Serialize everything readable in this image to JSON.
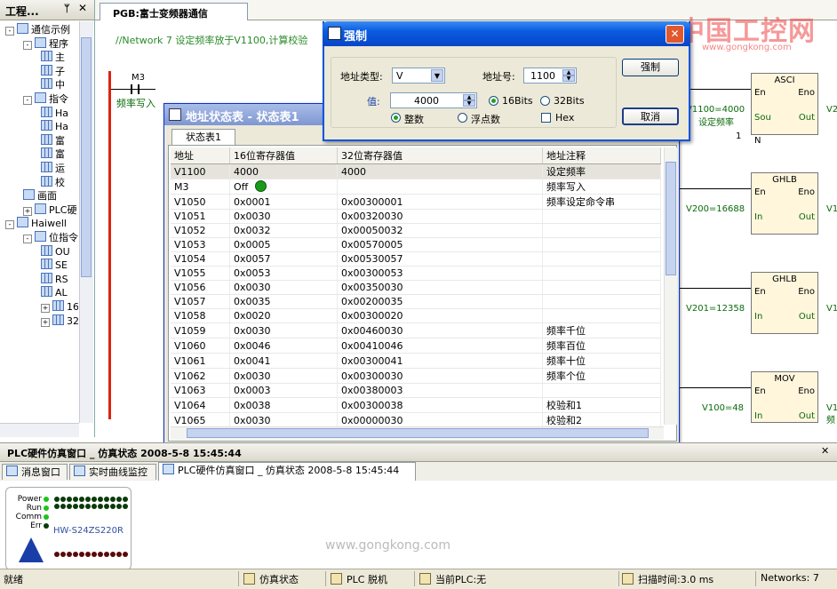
{
  "left_pane": {
    "title": "工程...",
    "pin_icon": "pin-icon",
    "tree": [
      {
        "label": "通信示例",
        "level": 1,
        "exp": "-"
      },
      {
        "label": "程序",
        "level": 2,
        "exp": "-"
      },
      {
        "label": "主",
        "level": 3
      },
      {
        "label": "子",
        "level": 3
      },
      {
        "label": "中",
        "level": 3
      },
      {
        "label": "指令",
        "level": 2,
        "exp": "-"
      },
      {
        "label": "Ha",
        "level": 3
      },
      {
        "label": "Ha",
        "level": 3
      },
      {
        "label": "富",
        "level": 3
      },
      {
        "label": "富",
        "level": 3
      },
      {
        "label": "运",
        "level": 3
      },
      {
        "label": "校",
        "level": 3
      },
      {
        "label": "画面",
        "level": 2
      },
      {
        "label": "PLC硬",
        "level": 2,
        "exp": "+"
      },
      {
        "label": "Haiwell",
        "level": 1,
        "exp": "-"
      },
      {
        "label": "位指令",
        "level": 2,
        "exp": "-"
      },
      {
        "label": "OU",
        "level": 3
      },
      {
        "label": "SE",
        "level": 3
      },
      {
        "label": "RS",
        "level": 3
      },
      {
        "label": "AL",
        "level": 3
      },
      {
        "label": "16",
        "level": 3,
        "exp": "+"
      },
      {
        "label": "32",
        "level": 3,
        "exp": "+"
      }
    ]
  },
  "doc_tab": {
    "label": "PGB:富士变频器通信"
  },
  "ladder": {
    "network_comment": "//Network 7  设定频率放于V1100,计算校验",
    "contact": "M3",
    "contact_comment": "频率写入",
    "blocks": [
      {
        "name": "ASCI",
        "en": "En",
        "eno": "Eno",
        "in": "Sou",
        "out": "Out",
        "left_label": "V1100=4000",
        "left_label2": "设定频率",
        "n_label": "1",
        "n_pin": "N",
        "right_label": "V2"
      },
      {
        "name": "GHLB",
        "en": "En",
        "eno": "Eno",
        "in": "In",
        "out": "Out",
        "left_label": "V200=16688",
        "right_label": "V1"
      },
      {
        "name": "GHLB",
        "en": "En",
        "eno": "Eno",
        "in": "In",
        "out": "Out",
        "left_label": "V201=12358",
        "right_label": "V1"
      },
      {
        "name": "MOV",
        "en": "En",
        "eno": "Eno",
        "in": "In",
        "out": "Out",
        "left_label": "V100=48",
        "right_label": "V1"
      }
    ],
    "right_partial": [
      "V2",
      "V1",
      "V1",
      "V1"
    ],
    "trailing_text": "频"
  },
  "watermark": {
    "cn": "中国工控网",
    "url": "www.gongkong.com",
    "bottom_url": "www.gongkong.com"
  },
  "status_table": {
    "title": "地址状态表 - 状态表1",
    "subtab": "状态表1",
    "columns": [
      "地址",
      "16位寄存器值",
      "32位寄存器值",
      "地址注释"
    ],
    "rows": [
      {
        "addr": "V1100",
        "v16": "4000",
        "v32": "4000",
        "note": "设定频率"
      },
      {
        "addr": "M3",
        "v16": "Off",
        "v32": "",
        "note": "频率写入",
        "indicator": true
      },
      {
        "addr": "V1050",
        "v16": "0x0001",
        "v32": "0x00300001",
        "note": "频率设定命令串"
      },
      {
        "addr": "V1051",
        "v16": "0x0030",
        "v32": "0x00320030",
        "note": ""
      },
      {
        "addr": "V1052",
        "v16": "0x0032",
        "v32": "0x00050032",
        "note": ""
      },
      {
        "addr": "V1053",
        "v16": "0x0005",
        "v32": "0x00570005",
        "note": ""
      },
      {
        "addr": "V1054",
        "v16": "0x0057",
        "v32": "0x00530057",
        "note": ""
      },
      {
        "addr": "V1055",
        "v16": "0x0053",
        "v32": "0x00300053",
        "note": ""
      },
      {
        "addr": "V1056",
        "v16": "0x0030",
        "v32": "0x00350030",
        "note": ""
      },
      {
        "addr": "V1057",
        "v16": "0x0035",
        "v32": "0x00200035",
        "note": ""
      },
      {
        "addr": "V1058",
        "v16": "0x0020",
        "v32": "0x00300020",
        "note": ""
      },
      {
        "addr": "V1059",
        "v16": "0x0030",
        "v32": "0x00460030",
        "note": "频率千位"
      },
      {
        "addr": "V1060",
        "v16": "0x0046",
        "v32": "0x00410046",
        "note": "频率百位"
      },
      {
        "addr": "V1061",
        "v16": "0x0041",
        "v32": "0x00300041",
        "note": "频率十位"
      },
      {
        "addr": "V1062",
        "v16": "0x0030",
        "v32": "0x00300030",
        "note": "频率个位"
      },
      {
        "addr": "V1063",
        "v16": "0x0003",
        "v32": "0x00380003",
        "note": ""
      },
      {
        "addr": "V1064",
        "v16": "0x0038",
        "v32": "0x00300038",
        "note": "校验和1"
      },
      {
        "addr": "V1065",
        "v16": "0x0030",
        "v32": "0x00000030",
        "note": "校验和2"
      }
    ]
  },
  "force_dialog": {
    "title": "强制",
    "addr_type_label": "地址类型:",
    "addr_type_value": "V",
    "addr_num_label": "地址号:",
    "addr_num_value": "1100",
    "value_label": "值:",
    "value": "4000",
    "bits16": "16Bits",
    "bits32": "32Bits",
    "int_label": "整数",
    "float_label": "浮点数",
    "hex_label": "Hex",
    "force_button": "强制",
    "cancel_button": "取消"
  },
  "hw_window": {
    "title": "PLC硬件仿真窗口 _ 仿真状态 2008-5-8 15:45:44",
    "tabs": [
      "消息窗口",
      "实时曲线监控",
      "PLC硬件仿真窗口 _ 仿真状态 2008-5-8 15:45:44"
    ],
    "leds": [
      "Power",
      "Run",
      "Comm",
      "Err"
    ],
    "model": "HW-S24ZS220R"
  },
  "statusbar": {
    "ready": "就绪",
    "sim": "仿真状态",
    "plc": "PLC 脱机",
    "current_plc": "当前PLC:无",
    "scan": "扫描时间:3.0 ms",
    "networks": "Networks: 7"
  }
}
